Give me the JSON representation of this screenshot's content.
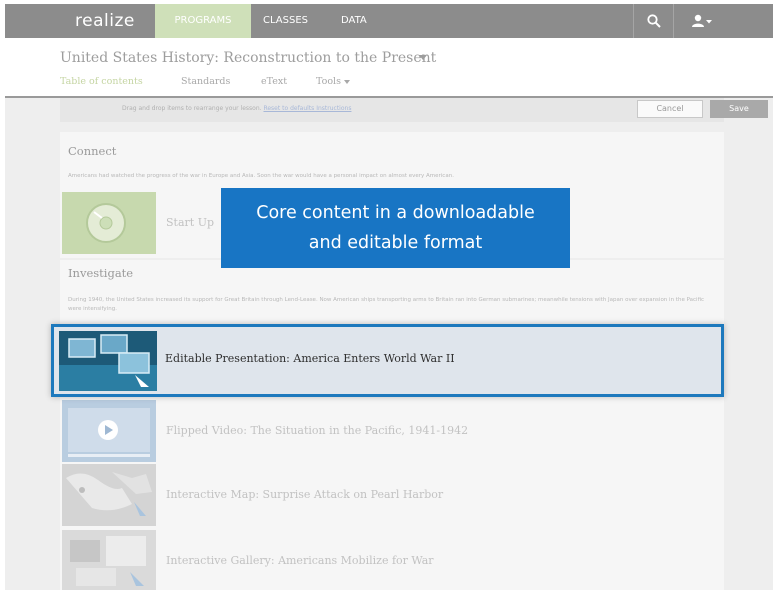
{
  "topbar": {
    "brand": "realize",
    "nav": [
      "PROGRAMS",
      "CLASSES",
      "DATA"
    ],
    "search_icon": "search-icon",
    "user_icon": "user-icon"
  },
  "course": {
    "title": "United States History: Reconstruction to the Present",
    "tabs": [
      "Table of contents",
      "Standards",
      "eText",
      "Tools"
    ]
  },
  "edit_bar": {
    "instruction": "Drag and drop items to rearrange your lesson.",
    "link": "Reset to defaults  Instructions",
    "cancel_label": "Cancel",
    "save_label": "Save"
  },
  "sections": [
    {
      "title": "Connect",
      "description": "Americans had watched the progress of the war in Europe and Asia. Soon the war would have a personal impact on almost every American.",
      "items": [
        {
          "title": "Start Up",
          "icon": "disc-icon"
        }
      ]
    },
    {
      "title": "Investigate",
      "description": "During 1940, the United States increased its support for Great Britain through Lend-Lease. Now American ships transporting arms to Britain ran into German submarines; meanwhile tensions with Japan over expansion in the Pacific were intensifying.",
      "items": [
        {
          "title": "Editable Presentation: America Enters World War II",
          "icon": "presentation-icon"
        },
        {
          "title": "Flipped Video: The Situation in the Pacific, 1941-1942",
          "icon": "play-icon"
        },
        {
          "title": "Interactive Map: Surprise Attack on Pearl Harbor",
          "icon": "map-icon"
        },
        {
          "title": "Interactive Gallery: Americans Mobilize for War",
          "icon": "gallery-icon"
        }
      ]
    }
  ],
  "callout": {
    "line1": "Core content in a downloadable",
    "line2": "and editable format"
  },
  "colors": {
    "topbar": "#8c8c8c",
    "programs_tab": "#cfe0b9",
    "callout": "#1875c4",
    "highlight_border": "#1d79bd"
  }
}
